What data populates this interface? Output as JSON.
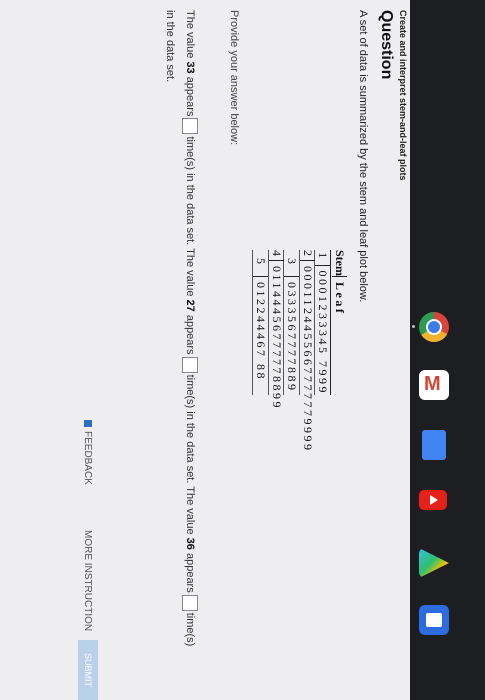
{
  "breadcrumb": "Create and interpret stem-and-leaf plots",
  "question_heading": "Question",
  "prompt": "A set of data is summarized by the stem and leaf plot below.",
  "plot": {
    "stem_header": "Stem",
    "leaf_header": "Leaf",
    "rows": [
      {
        "stem": "1",
        "leaf": "0001233345 7999"
      },
      {
        "stem": "2",
        "leaf": "0001124455667777779999"
      },
      {
        "stem": "3",
        "leaf": "0333567777889"
      },
      {
        "stem": "4",
        "leaf": "01144456777778899"
      },
      {
        "stem": "5",
        "leaf": "012244467 88"
      }
    ]
  },
  "provide_label": "Provide your answer below:",
  "answer": {
    "p1": "The value",
    "v1": "33",
    "p2": "appears",
    "p3": "time(s) in the data set. The value",
    "v2": "27",
    "p4": "appears",
    "p5": "time(s) in the data set. The value",
    "v3": "36",
    "p6": "appears",
    "p7": "time(s) in the data set."
  },
  "footer": {
    "feedback": "FEEDBACK",
    "more_instruction": "MORE INSTRUCTION",
    "submit": "SUBMIT"
  },
  "taskbar": {
    "apps": [
      "chrome-icon",
      "gmail-icon",
      "docs-icon",
      "youtube-icon",
      "play-store-icon",
      "files-icon"
    ]
  }
}
